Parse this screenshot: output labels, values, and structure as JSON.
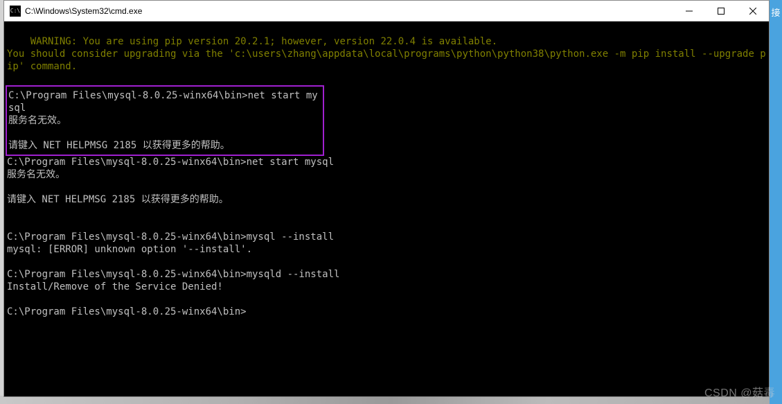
{
  "window": {
    "title": "C:\\Windows\\System32\\cmd.exe",
    "icon_label": "C:\\"
  },
  "terminal": {
    "warning_line1": "WARNING: You are using pip version 20.2.1; however, version 22.0.4 is available.",
    "warning_line2": "You should consider upgrading via the 'c:\\users\\zhang\\appdata\\local\\programs\\python\\python38\\python.exe -m pip install --upgrade pip' command.",
    "block1_prompt": "C:\\Program Files\\mysql-8.0.25-winx64\\bin>net start mysql",
    "block1_line2": "服务名无效。",
    "block1_line3": "请键入 NET HELPMSG 2185 以获得更多的帮助。",
    "block2_prompt": "C:\\Program Files\\mysql-8.0.25-winx64\\bin>net start mysql",
    "block2_line2": "服务名无效。",
    "block2_line3": "请键入 NET HELPMSG 2185 以获得更多的帮助。",
    "block3_prompt": "C:\\Program Files\\mysql-8.0.25-winx64\\bin>mysql --install",
    "block3_line2": "mysql: [ERROR] unknown option '--install'.",
    "block4_prompt": "C:\\Program Files\\mysql-8.0.25-winx64\\bin>mysqld --install",
    "block4_line2": "Install/Remove of the Service Denied!",
    "block5_prompt": "C:\\Program Files\\mysql-8.0.25-winx64\\bin>"
  },
  "watermark": "CSDN @菇毒",
  "side_char": "接"
}
